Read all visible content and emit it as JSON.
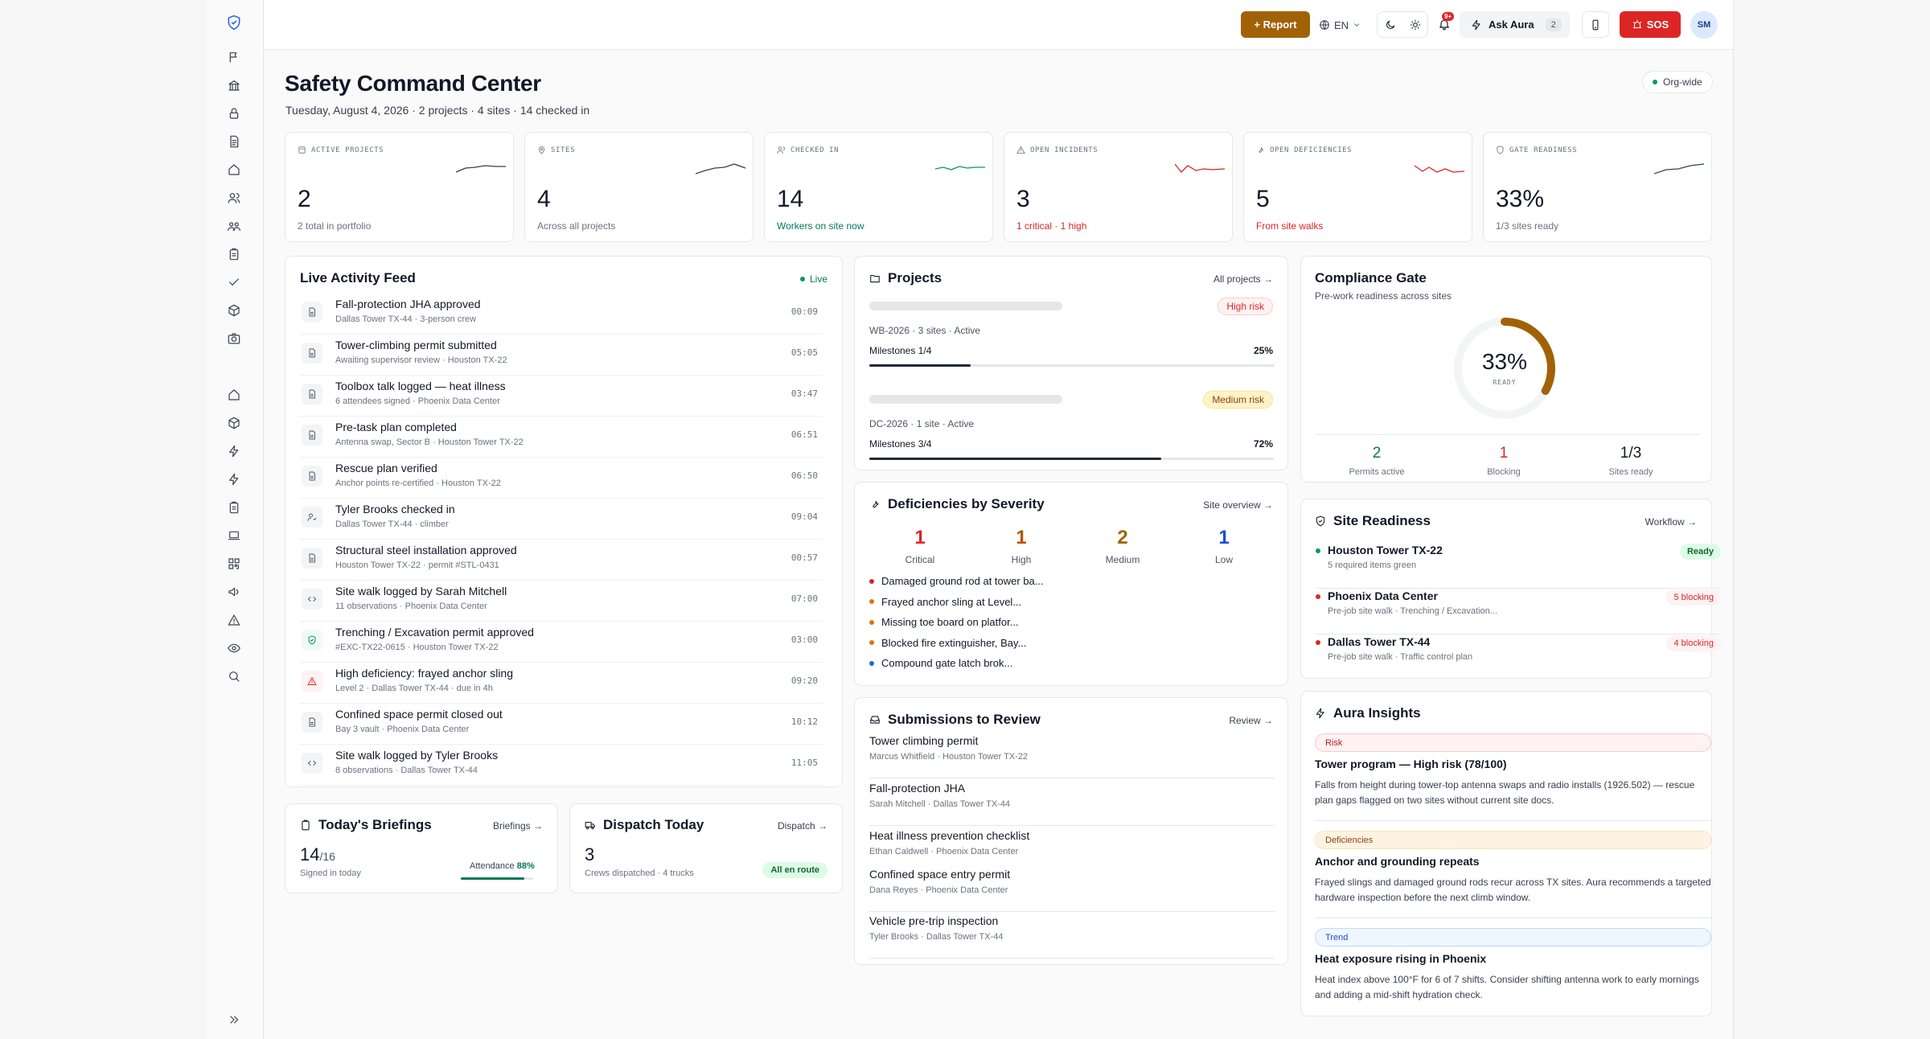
{
  "topbar": {
    "report_label": "+ Report",
    "lang_label": "EN",
    "notif_badge": "9+",
    "ask_label": "Ask Aura",
    "ask_count": "2",
    "sos_label": "SOS",
    "avatar_initials": "SM"
  },
  "header": {
    "title": "Safety Command Center",
    "subtitle": "Tuesday, August 4, 2026 · 2 projects · 4 sites · 14 checked in",
    "scope_label": "Org-wide"
  },
  "kpis": [
    {
      "label": "ACTIVE PROJECTS",
      "value": "2",
      "note": "2 total in portfolio",
      "icon": "projects-icon",
      "trend_color": "#374151",
      "note_color": "#6b7280"
    },
    {
      "label": "SITES",
      "value": "4",
      "note": "Across all projects",
      "icon": "map-pin-icon",
      "trend_color": "#374151",
      "note_color": "#6b7280"
    },
    {
      "label": "CHECKED IN",
      "value": "14",
      "note": "Workers on site now",
      "icon": "users-icon",
      "trend_color": "#059669",
      "note_color": "#047857"
    },
    {
      "label": "OPEN INCIDENTS",
      "value": "3",
      "note": "1 critical · 1 high",
      "icon": "alert-icon",
      "trend_color": "#dc2626",
      "note_color": "#dc2626"
    },
    {
      "label": "OPEN DEFICIENCIES",
      "value": "5",
      "note": "From site walks",
      "icon": "wrench-icon",
      "trend_color": "#dc2626",
      "note_color": "#dc2626"
    },
    {
      "label": "GATE READINESS",
      "value": "33%",
      "note": "1/3 sites ready",
      "icon": "shield-icon",
      "trend_color": "#374151",
      "note_color": "#6b7280"
    }
  ],
  "feed": {
    "title": "Live Activity Feed",
    "live_label": "Live",
    "items": [
      {
        "title": "Fall-protection JHA approved",
        "sub": "Dallas Tower TX-44 · 3-person crew",
        "time": "00:09",
        "icon": "document-icon"
      },
      {
        "title": "Tower-climbing permit submitted",
        "sub": "Awaiting supervisor review · Houston TX-22",
        "time": "05:05",
        "icon": "document-icon"
      },
      {
        "title": "Toolbox talk logged — heat illness",
        "sub": "6 attendees signed · Phoenix Data Center",
        "time": "03:47",
        "icon": "document-icon"
      },
      {
        "title": "Pre-task plan completed",
        "sub": "Antenna swap, Sector B · Houston Tower TX-22",
        "time": "06:51",
        "icon": "document-icon"
      },
      {
        "title": "Rescue plan verified",
        "sub": "Anchor points re-certified · Houston TX-22",
        "time": "06:50",
        "icon": "document-icon"
      },
      {
        "title": "Tyler Brooks checked in",
        "sub": "Dallas Tower TX-44 · climber",
        "time": "09:04",
        "icon": "user-check-icon"
      },
      {
        "title": "Structural steel installation approved",
        "sub": "Houston Tower TX-22 · permit #STL-0431",
        "time": "00:57",
        "icon": "document-icon"
      },
      {
        "title": "Site walk logged by Sarah Mitchell",
        "sub": "11 observations · Phoenix Data Center",
        "time": "07:00",
        "icon": "eye-icon"
      },
      {
        "title": "Trenching / Excavation permit approved",
        "sub": "#EXC-TX22-0615 · Houston Tower TX-22",
        "time": "03:00",
        "icon": "shield-check-icon"
      },
      {
        "title": "High deficiency: frayed anchor sling",
        "sub": "Level 2 · Dallas Tower TX-44 · due in 4h",
        "time": "09:20",
        "icon": "warning-icon"
      },
      {
        "title": "Confined space permit closed out",
        "sub": "Bay 3 vault · Phoenix Data Center",
        "time": "10:12",
        "icon": "document-icon"
      },
      {
        "title": "Site walk logged by Tyler Brooks",
        "sub": "8 observations · Dallas Tower TX-44",
        "time": "11:05",
        "icon": "eye-icon"
      }
    ]
  },
  "briefings": {
    "title": "Today's Briefings",
    "link": "Briefings →",
    "signed": "14",
    "total": "/16",
    "sub": "Signed in today",
    "attendance_label": "Attendance",
    "attendance_value": "88%",
    "attendance_fraction": 0.88
  },
  "dispatch": {
    "title": "Dispatch Today",
    "link": "Dispatch →",
    "value": "3",
    "sub": "Crews dispatched · 4 trucks",
    "status": "All en route"
  },
  "projects": {
    "title": "Projects",
    "link": "All projects →",
    "items": [
      {
        "risk": "High risk",
        "meta": "WB-2026 · 3 sites · Active",
        "milestones": "Milestones 1/4",
        "pct": "25%",
        "fraction": 0.25
      },
      {
        "risk": "Medium risk",
        "meta": "DC-2026 · 1 site · Active",
        "milestones": "Milestones 3/4",
        "pct": "72%",
        "fraction": 0.72
      }
    ]
  },
  "deficiencies": {
    "title": "Deficiencies by Severity",
    "link": "Site overview →",
    "severities": [
      {
        "count": "1",
        "label": "Critical",
        "color": "#dc2626"
      },
      {
        "count": "1",
        "label": "High",
        "color": "#b45309"
      },
      {
        "count": "2",
        "label": "Medium",
        "color": "#a16207"
      },
      {
        "count": "1",
        "label": "Low",
        "color": "#1d4ed8"
      }
    ],
    "items": [
      {
        "text": "Damaged ground rod at tower ba...",
        "color": "#dc2626"
      },
      {
        "text": "Frayed anchor sling at Level...",
        "color": "#d97706"
      },
      {
        "text": "Missing toe board on platfor...",
        "color": "#d97706"
      },
      {
        "text": "Blocked fire extinguisher, Bay...",
        "color": "#d97706"
      },
      {
        "text": "Compound gate latch brok...",
        "color": "#2563eb"
      }
    ]
  },
  "submissions": {
    "title": "Submissions to Review",
    "link": "Review →",
    "items": [
      {
        "title": "Tower climbing permit",
        "sub": "Marcus Whitfield · Houston Tower TX-22"
      },
      {
        "title": "Fall-protection JHA",
        "sub": "Sarah Mitchell · Dallas Tower TX-44"
      },
      {
        "title": "Heat illness prevention checklist",
        "sub": "Ethan Caldwell · Phoenix Data Center"
      },
      {
        "title": "Confined space entry permit",
        "sub": "Dana Reyes · Phoenix Data Center"
      },
      {
        "title": "Vehicle pre-trip inspection",
        "sub": "Tyler Brooks · Dallas Tower TX-44"
      }
    ]
  },
  "gate": {
    "title": "Compliance Gate",
    "sub": "Pre-work readiness across sites",
    "pct": "33%",
    "ring_label": "READY",
    "fraction": 0.33,
    "stats": [
      {
        "value": "2",
        "label": "Permits active",
        "color": "#047857"
      },
      {
        "value": "1",
        "label": "Blocking",
        "color": "#dc2626"
      },
      {
        "value": "1/3",
        "label": "Sites ready",
        "color": "#111827"
      }
    ]
  },
  "readiness": {
    "title": "Site Readiness",
    "link": "Workflow →",
    "sites": [
      {
        "name": "Houston Tower TX-22",
        "sub": "5 required items green",
        "badge": "Ready",
        "status": "ready"
      },
      {
        "name": "Phoenix Data Center",
        "sub": "Pre-job site walk · Trenching / Excavation...",
        "badge": "5 blocking",
        "status": "blocking"
      },
      {
        "name": "Dallas Tower TX-44",
        "sub": "Pre-job site walk · Traffic control plan",
        "badge": "4 blocking",
        "status": "blocking"
      }
    ]
  },
  "insights": {
    "title": "Aura Insights",
    "items": [
      {
        "tag": "Risk",
        "title": "Tower program — High risk (78/100)",
        "body": "Falls from height during tower-top antenna swaps and radio installs (1926.502) — rescue plan gaps flagged on two sites without current site docs."
      },
      {
        "tag": "Deficiencies",
        "title": "Anchor and grounding repeats",
        "body": "Frayed slings and damaged ground rods recur across TX sites. Aura recommends a targeted hardware inspection before the next climb window."
      },
      {
        "tag": "Trend",
        "title": "Heat exposure rising in Phoenix",
        "body": "Heat index above 100°F for 6 of 7 shifts. Consider shifting antenna work to early mornings and adding a mid-shift hydration check."
      }
    ]
  }
}
